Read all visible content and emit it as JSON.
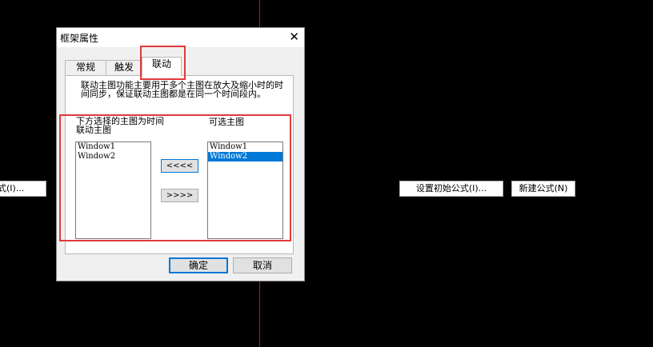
{
  "background_buttons": {
    "left_partial": "式(I)...",
    "set_initial_formula": "设置初始公式(I)...",
    "new_formula": "新建公式(N)"
  },
  "dialog": {
    "title": "框架属性",
    "close_glyph": "✕",
    "tabs": [
      "常规",
      "触发",
      "联动"
    ],
    "active_tab": "联动",
    "description": "联动主图功能主要用于多个主图在放大及缩小时的时间同步，保证联动主图都是在同一个时间段内。",
    "left_label": "下方选择的主图为时间联动主图",
    "right_label": "可选主图",
    "left_list": [
      "Window1",
      "Window2"
    ],
    "right_list": [
      "Window1",
      "Window2"
    ],
    "right_selected_index": 1,
    "move_left_label": "<<<<",
    "move_right_label": ">>>>",
    "ok_label": "确定",
    "cancel_label": "取消"
  },
  "colors": {
    "highlight": "#e03a3a",
    "selection": "#0078d7",
    "divider_line": "#c0141e"
  }
}
